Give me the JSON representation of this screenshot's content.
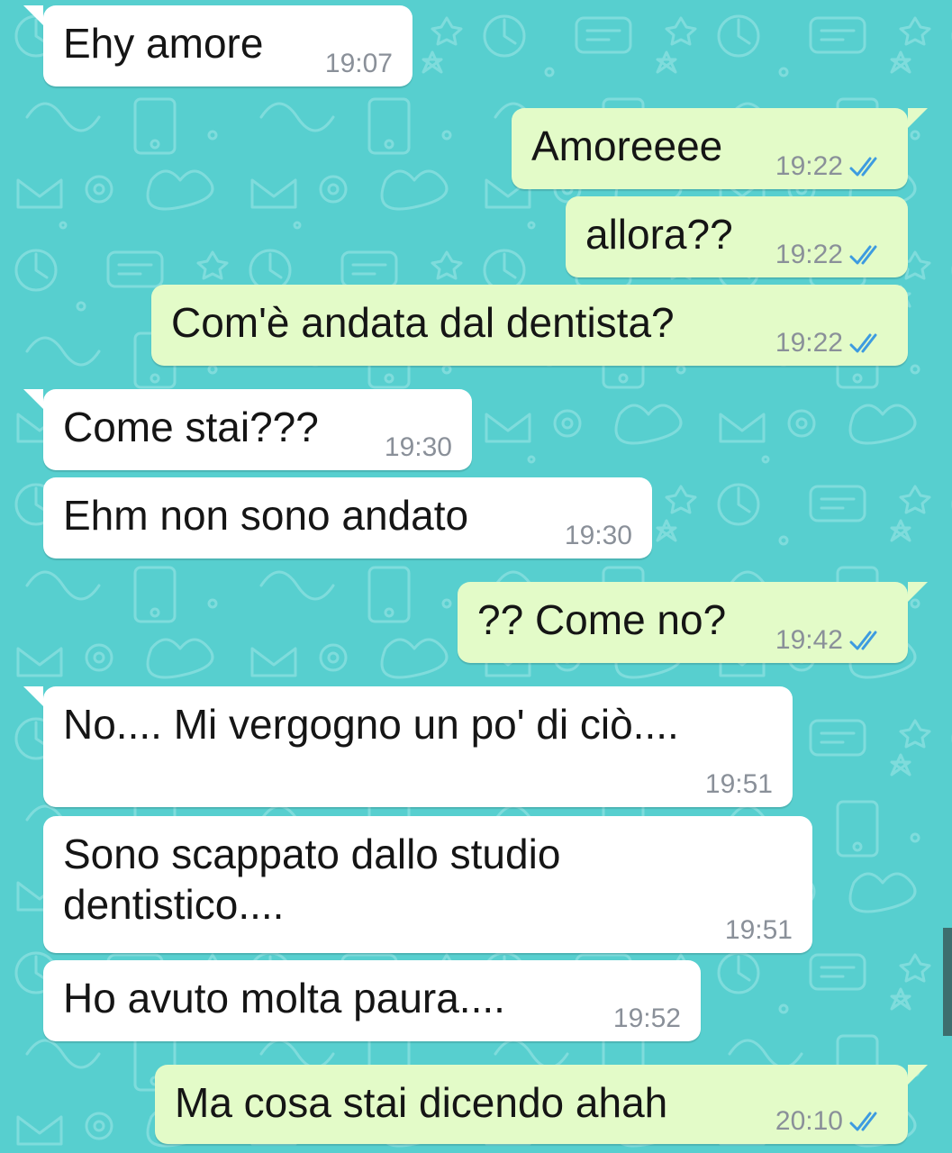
{
  "theme": {
    "background": "#57cfcf",
    "incoming_bubble": "#ffffff",
    "outgoing_bubble": "#e3fbc8",
    "read_tick_color": "#3d9be0"
  },
  "messages": [
    {
      "direction": "incoming",
      "text": "Ehy amore",
      "time": "19:07"
    },
    {
      "direction": "outgoing",
      "text": "Amoreeee",
      "time": "19:22",
      "status": "read-double-tick-icon"
    },
    {
      "direction": "outgoing",
      "text": "allora??",
      "time": "19:22",
      "status": "read-double-tick-icon"
    },
    {
      "direction": "outgoing",
      "text": "Com'è andata dal dentista?",
      "time": "19:22",
      "status": "read-double-tick-icon"
    },
    {
      "direction": "incoming",
      "text": "Come stai???",
      "time": "19:30"
    },
    {
      "direction": "incoming",
      "text": "Ehm non sono andato",
      "time": "19:30"
    },
    {
      "direction": "outgoing",
      "text": "?? Come no?",
      "time": "19:42",
      "status": "read-double-tick-icon"
    },
    {
      "direction": "incoming",
      "text": "No.... Mi vergogno un po' di ciò....",
      "time": "19:51"
    },
    {
      "direction": "incoming",
      "text": "Sono scappato dallo studio dentistico....",
      "time": "19:51"
    },
    {
      "direction": "incoming",
      "text": "Ho avuto molta paura....",
      "time": "19:52"
    },
    {
      "direction": "outgoing",
      "text": "Ma cosa stai dicendo ahah",
      "time": "20:10",
      "status": "read-double-tick-icon"
    }
  ]
}
